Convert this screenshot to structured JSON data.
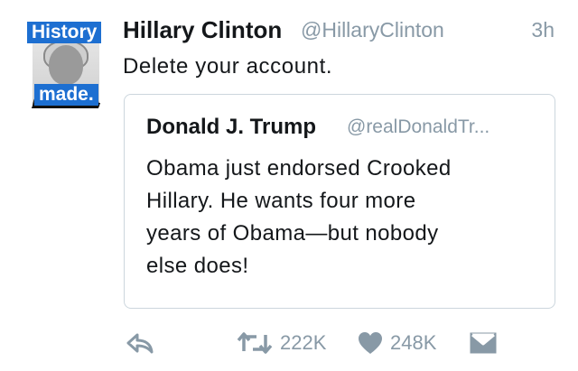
{
  "tweet": {
    "author": {
      "name": "Hillary Clinton",
      "handle": "@HillaryClinton",
      "avatar_label_top": "History",
      "avatar_label_bottom": "made."
    },
    "timestamp": "3h",
    "text": "Delete your account.",
    "quoted": {
      "author_name": "Donald J. Trump",
      "author_handle": "@realDonaldTr...",
      "text_lines": [
        "Obama just endorsed Crooked",
        "Hillary. He wants four more",
        "years of Obama—but nobody",
        "else does!"
      ]
    },
    "actions": {
      "reply_icon": "reply-icon",
      "retweet_icon": "retweet-icon",
      "retweet_count": "222K",
      "like_icon": "heart-icon",
      "like_count": "248K",
      "dm_icon": "direct-message-icon"
    }
  },
  "colors": {
    "text": "#14171a",
    "secondary": "#8899a6",
    "border": "#ccd6dd",
    "avatar_label": "#1d6fd1"
  }
}
